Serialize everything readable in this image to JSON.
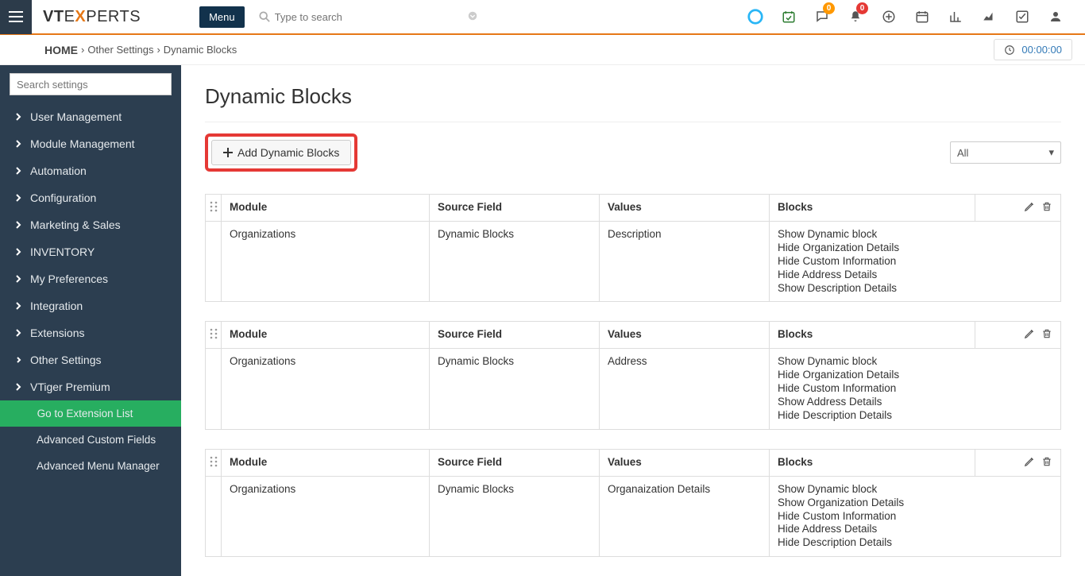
{
  "header": {
    "menu_label": "Menu",
    "search_placeholder": "Type to search",
    "chat_badge": "0",
    "bell_badge": "0"
  },
  "breadcrumb": {
    "home": "HOME",
    "items": [
      "Other Settings",
      "Dynamic Blocks"
    ]
  },
  "timer": {
    "value": "00:00:00"
  },
  "sidebar": {
    "search_placeholder": "Search settings",
    "items": [
      {
        "label": "User Management"
      },
      {
        "label": "Module Management"
      },
      {
        "label": "Automation"
      },
      {
        "label": "Configuration"
      },
      {
        "label": "Marketing & Sales"
      },
      {
        "label": "INVENTORY"
      },
      {
        "label": "My Preferences"
      },
      {
        "label": "Integration"
      },
      {
        "label": "Extensions"
      },
      {
        "label": "Other Settings",
        "expanded": true
      },
      {
        "label": "VTiger Premium"
      }
    ],
    "sub": {
      "go_to_ext": "Go to Extension List",
      "items": [
        "Advanced Custom Fields",
        "Advanced Menu Manager"
      ]
    }
  },
  "page": {
    "title": "Dynamic Blocks",
    "add_button": "Add Dynamic Blocks",
    "filter_selected": "All"
  },
  "columns": {
    "module": "Module",
    "source_field": "Source Field",
    "values": "Values",
    "blocks": "Blocks"
  },
  "rows": [
    {
      "module": "Organizations",
      "source_field": "Dynamic Blocks",
      "values": "Description",
      "blocks": [
        "Show Dynamic block",
        "Hide Organization Details",
        "Hide Custom Information",
        "Hide Address Details",
        "Show Description Details"
      ]
    },
    {
      "module": "Organizations",
      "source_field": "Dynamic Blocks",
      "values": "Address",
      "blocks": [
        "Show Dynamic block",
        "Hide Organization Details",
        "Hide Custom Information",
        "Show Address Details",
        "Hide Description Details"
      ]
    },
    {
      "module": "Organizations",
      "source_field": "Dynamic Blocks",
      "values": "Organaization Details",
      "blocks": [
        "Show Dynamic block",
        "Show Organization Details",
        "Hide Custom Information",
        "Hide Address Details",
        "Hide Description Details"
      ]
    }
  ]
}
